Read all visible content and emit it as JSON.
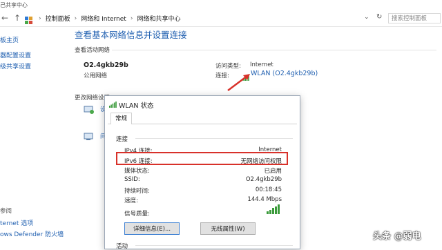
{
  "window": {
    "title": "己共享中心"
  },
  "address_bar": {
    "back": "←",
    "up": "↑",
    "breadcrumbs": [
      "控制面板",
      "网络和 Internet",
      "网络和共享中心"
    ],
    "dropdown": "⌄",
    "refresh": "↻",
    "search_placeholder": "搜索控制面板"
  },
  "sidebar": {
    "items": [
      "板主页",
      "器配置设置",
      "级共享设置"
    ],
    "see_also": "参阅",
    "bottom_items": [
      "ternet 选项",
      "ows Defender 防火墙"
    ]
  },
  "main": {
    "heading": "查看基本网络信息并设置连接",
    "active_networks_label": "查看活动网络",
    "network_name": "O2.4gkb29b",
    "network_type": "公用网络",
    "access_type_label": "访问类型:",
    "access_type_value": "Internet",
    "connection_label": "连接:",
    "connection_value": "WLAN (O2.4gkb29b)",
    "change_settings_label": "更改网络设置"
  },
  "dialog": {
    "title": "WLAN 状态",
    "tab": "常规",
    "section_connection": "连接",
    "rows": [
      {
        "label": "IPv4 连接:",
        "value": "Internet"
      },
      {
        "label": "IPv6 连接:",
        "value": "无网络访问权限"
      },
      {
        "label": "媒体状态:",
        "value": "已启用"
      },
      {
        "label": "SSID:",
        "value": "O2.4gkb29b"
      },
      {
        "label": "持续时间:",
        "value": "00:18:45"
      },
      {
        "label": "速度:",
        "value": "144.4 Mbps"
      }
    ],
    "signal_label": "信号质量:",
    "signal_bars": 5,
    "details_button": "详细信息(E)...",
    "wireless_button": "无线属性(W)",
    "section_activity": "活动"
  },
  "watermark": "头条 @弱电",
  "colors": {
    "link": "#1f5fb0",
    "highlight": "#d8312a",
    "signal": "#3a9a3a"
  }
}
